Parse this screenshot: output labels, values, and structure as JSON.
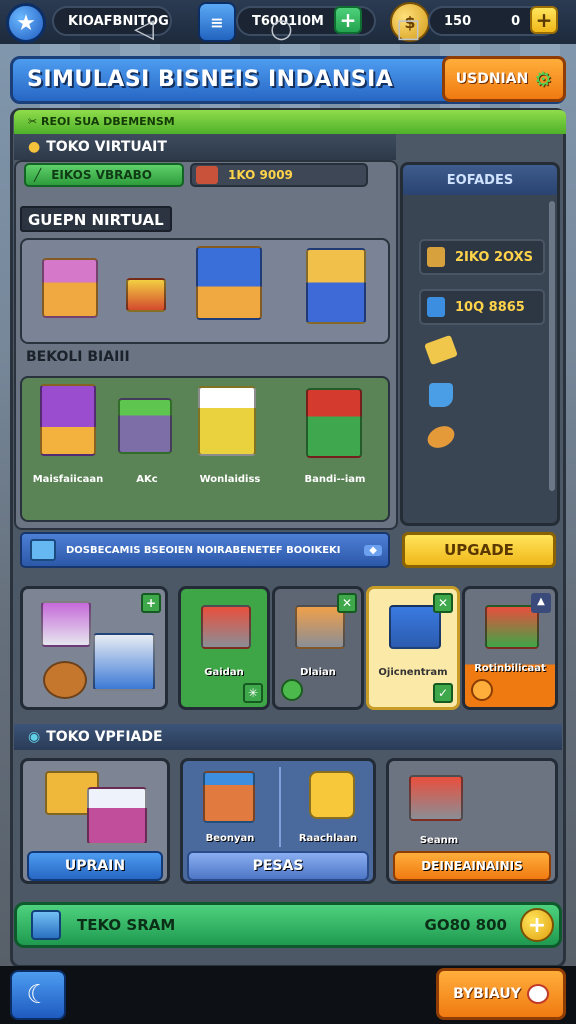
{
  "topbar": {
    "player_name": "KIOAFBNITOG",
    "coins": "T6001I0M",
    "gems": "150",
    "gems_secondary": "0"
  },
  "title": {
    "text": "SIMULASI BISNEIS INDANSIA",
    "button_label": "USDNIAN"
  },
  "banner": {
    "text": "REOI SUA DBEMENSM"
  },
  "toko_virtual": {
    "heading": "TOKO VIRTUAIT",
    "green_chip": "EIKOS VBRABO",
    "counter": "1KO 9009"
  },
  "gudang": {
    "label": "GUEPN NIRTUAL"
  },
  "bekal": {
    "label": "BEKOLI BIAIII",
    "items": [
      "Maisfaiicaan",
      "AKc",
      "Wonlaidiss",
      "Bandi--iam"
    ]
  },
  "side": {
    "heading": "EOFADES",
    "chip1": "2IKO 2OXS",
    "chip2": "10Q 8865"
  },
  "upgrade_row": {
    "bar_text": "DOSBECAMIS BSEOIEN NOIRABENETEF BOOIKEKI",
    "button": "UPGADE"
  },
  "carts": [
    {
      "label": "Gaidan"
    },
    {
      "label": "Dlaian"
    },
    {
      "label": "Ojicnentram"
    },
    {
      "label": "Rotinbilicaat"
    }
  ],
  "toko_upgrade": {
    "heading": "TOKO VPFIADE",
    "cards": [
      {
        "button": "UPRAIN"
      },
      {
        "caption_left": "Beonyan",
        "caption_right": "Raachlaan",
        "button": "PESAS"
      },
      {
        "caption": "Seanm",
        "button": "DEINEAINAINIS"
      }
    ]
  },
  "bottom_bar": {
    "label": "TEKO SRAM",
    "value": "GO80 800"
  },
  "nav": {
    "corner_button": "BYBIAUY"
  },
  "colors": {
    "accent_blue": "#2767c4",
    "accent_green": "#4fb12a",
    "accent_orange": "#f07a12",
    "accent_yellow": "#f0b81a"
  }
}
